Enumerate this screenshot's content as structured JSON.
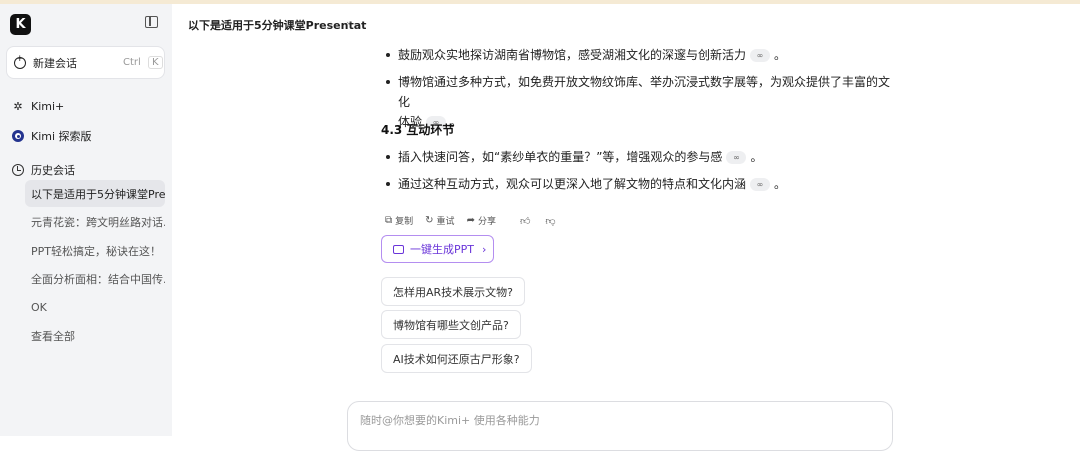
{
  "sidebar": {
    "logo": "K",
    "new_chat": {
      "label": "新建会话",
      "shortcut_mod": "Ctrl",
      "shortcut_key": "K"
    },
    "kimi_plus": "Kimi+",
    "explore": "Kimi 探索版",
    "history_label": "历史会话",
    "history": [
      "以下是适用于5分钟课堂Pre...",
      "元青花瓷：跨文明丝路对话...",
      "PPT轻松搞定，秘诀在这！",
      "全面分析面相：结合中国传...",
      "OK",
      "查看全部"
    ]
  },
  "header": {
    "title": "以下是适用于5分钟课堂Presentat",
    "chevron": "⌄"
  },
  "content": {
    "bullets_top": [
      "鼓励观众实地探访湖南省博物馆，感受湖湘文化的深邃与创新活力",
      "博物馆通过多种方式，如免费开放文物纹饰库、举办沉浸式数字展等，为观众提供了丰富的文化",
      "体验"
    ],
    "section_heading": "4.3 互动环节",
    "bullets_bottom": [
      "插入快速问答，如“素纱单衣的重量？”等，增强观众的参与感",
      "通过这种互动方式，观众可以更深入地了解文物的特点和文化内涵"
    ],
    "ref_glyph": "∞",
    "period": "。"
  },
  "actions": {
    "copy": "复制",
    "retry": "重试",
    "share": "分享"
  },
  "ppt_button": "一键生成PPT",
  "suggestions": [
    "怎样用AR技术展示文物?",
    "博物馆有哪些文创产品?",
    "AI技术如何还原古尸形象?"
  ],
  "input": {
    "placeholder": "随时@你想要的Kimi+ 使用各种能力"
  },
  "colors": {
    "accent": "#6a35d9",
    "sidebar_bg": "#f3f4f6"
  }
}
